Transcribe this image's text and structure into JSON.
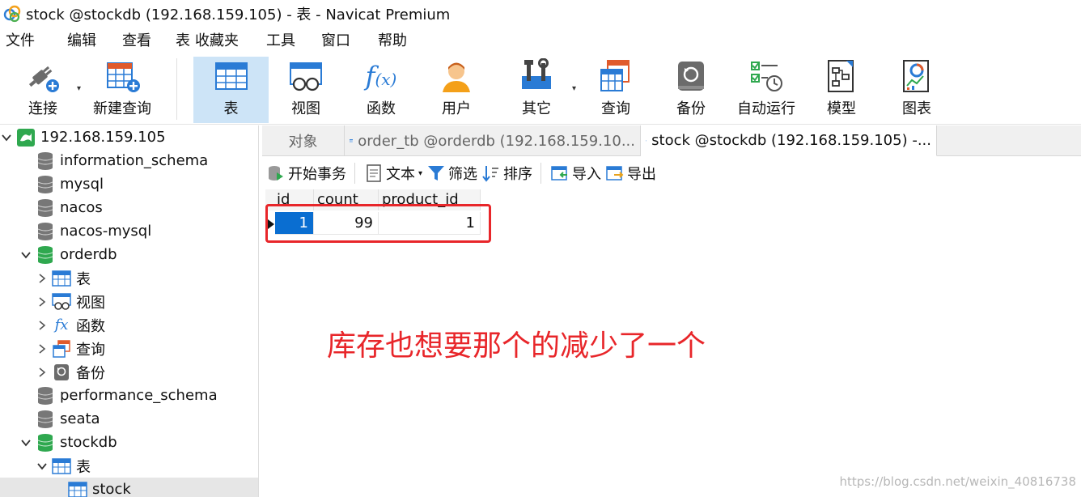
{
  "window": {
    "title": "stock @stockdb (192.168.159.105) - 表 - Navicat Premium"
  },
  "menu": [
    "文件",
    "编辑",
    "查看",
    "表",
    "收藏夹",
    "工具",
    "窗口",
    "帮助"
  ],
  "toolbar": {
    "connect": "连接",
    "new_query": "新建查询",
    "table": "表",
    "view": "视图",
    "function": "函数",
    "user": "用户",
    "other": "其它",
    "query": "查询",
    "backup": "备份",
    "auto_run": "自动运行",
    "model": "模型",
    "chart": "图表"
  },
  "sidebar": {
    "connection": "192.168.159.105",
    "databases": {
      "information_schema": "information_schema",
      "mysql": "mysql",
      "nacos": "nacos",
      "nacos_mysql": "nacos-mysql",
      "orderdb": "orderdb",
      "performance_schema": "performance_schema",
      "seata": "seata",
      "stockdb": "stockdb"
    },
    "orderdb_children": {
      "tables": "表",
      "views": "视图",
      "functions": "函数",
      "queries": "查询",
      "backups": "备份"
    },
    "stockdb_children": {
      "tables": "表",
      "stock": "stock"
    }
  },
  "tabs": {
    "objects": "对象",
    "order_tb": "order_tb @orderdb (192.168.159.10...",
    "stock": "stock @stockdb (192.168.159.105) -..."
  },
  "subtoolbar": {
    "begin_transaction": "开始事务",
    "text": "文本",
    "filter": "筛选",
    "sort": "排序",
    "import": "导入",
    "export": "导出"
  },
  "grid": {
    "columns": [
      "id",
      "count",
      "product_id"
    ],
    "rows": [
      [
        "1",
        "99",
        "1"
      ]
    ]
  },
  "annotation": "库存也想要那个的减少了一个",
  "watermark": "https://blog.csdn.net/weixin_40816738",
  "colors": {
    "accent": "#0a6ed1",
    "annotation_red": "#e8262a",
    "active_tool": "#cde4f7",
    "db_green": "#2fa84f"
  }
}
